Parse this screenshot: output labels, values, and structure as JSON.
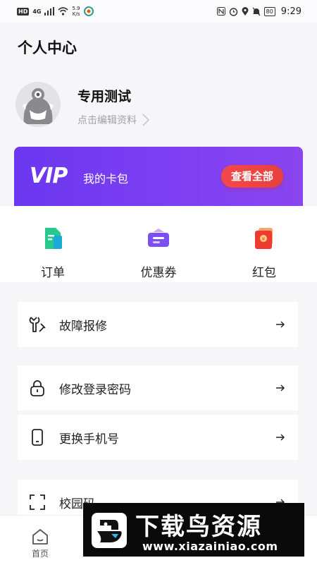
{
  "status_bar": {
    "hd": "HD",
    "network": "4G",
    "speed": "5.9",
    "speed_unit": "K/s",
    "battery": "80",
    "time": "9:29"
  },
  "page": {
    "title": "个人中心"
  },
  "profile": {
    "name": "专用测试",
    "edit_label": "点击编辑资料"
  },
  "vip": {
    "logo": "VIP",
    "label": "我的卡包",
    "button": "查看全部",
    "colors": {
      "gradient_start": "#6a37f0",
      "gradient_end": "#8a45f0",
      "button": "#f2484b"
    }
  },
  "shortcuts": [
    {
      "label": "订单",
      "icon": "order-icon"
    },
    {
      "label": "优惠券",
      "icon": "coupon-icon"
    },
    {
      "label": "红包",
      "icon": "red-packet-icon"
    }
  ],
  "menu": [
    {
      "label": "故障报修",
      "icon": "repair-icon"
    },
    {
      "label": "修改登录密码",
      "icon": "lock-icon"
    },
    {
      "label": "更换手机号",
      "icon": "phone-icon"
    },
    {
      "label": "校园码",
      "icon": "qr-scan-icon"
    }
  ],
  "tabbar": {
    "items": [
      {
        "label": "首页",
        "icon": "home-icon"
      }
    ]
  },
  "watermark": {
    "title": "下载鸟资源",
    "url": "www.xiazainiao.com"
  }
}
